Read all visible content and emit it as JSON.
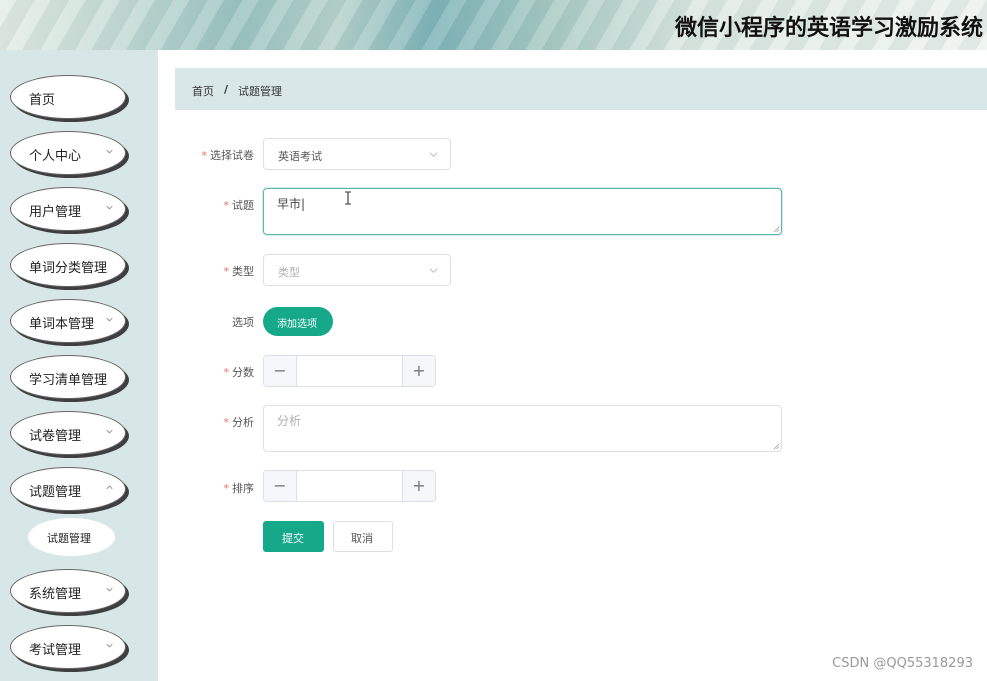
{
  "header": {
    "title": "微信小程序的英语学习激励系统"
  },
  "sidebar": {
    "items": [
      {
        "label": "首页",
        "has_arrow": false
      },
      {
        "label": "个人中心",
        "has_arrow": true
      },
      {
        "label": "用户管理",
        "has_arrow": true
      },
      {
        "label": "单词分类管理",
        "has_arrow": false
      },
      {
        "label": "单词本管理",
        "has_arrow": true
      },
      {
        "label": "学习清单管理",
        "has_arrow": false
      },
      {
        "label": "试卷管理",
        "has_arrow": true
      },
      {
        "label": "试题管理",
        "has_arrow": true
      },
      {
        "label": "系统管理",
        "has_arrow": true
      },
      {
        "label": "考试管理",
        "has_arrow": true
      }
    ],
    "sub_item": {
      "label": "试题管理"
    }
  },
  "breadcrumb": {
    "home": "首页",
    "separator": "/",
    "current": "试题管理"
  },
  "form": {
    "paper": {
      "label": "选择试卷",
      "value": "英语考试"
    },
    "question": {
      "label": "试题",
      "value": "早市|"
    },
    "type": {
      "label": "类型",
      "placeholder": "类型"
    },
    "options": {
      "label": "选项",
      "add_button": "添加选项"
    },
    "score": {
      "label": "分数",
      "value": "",
      "dec": "−",
      "inc": "+"
    },
    "analysis": {
      "label": "分析",
      "placeholder": "分析"
    },
    "order": {
      "label": "排序",
      "value": "",
      "dec": "−",
      "inc": "+"
    },
    "submit": "提交",
    "cancel": "取消",
    "required_mark": "*"
  },
  "watermark": "CSDN @QQ55318293",
  "colors": {
    "primary": "#15a98a",
    "sidebar_bg": "#d7e6e7",
    "required": "#f56c6c"
  }
}
